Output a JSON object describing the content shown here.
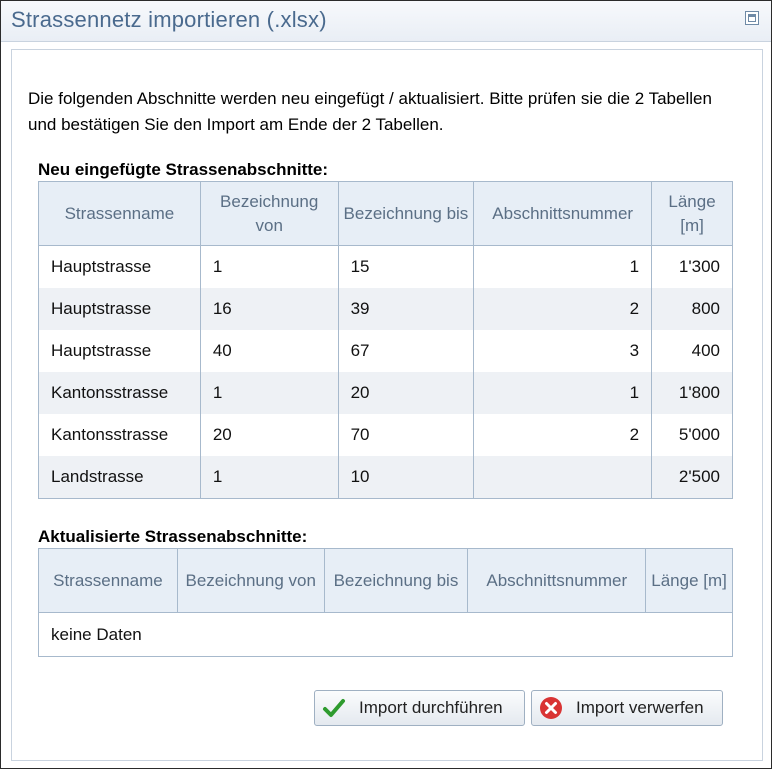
{
  "window": {
    "title": "Strassennetz importieren (.xlsx)"
  },
  "intro": "Die folgenden Abschnitte werden neu eingefügt / aktualisiert. Bitte prüfen sie die 2 Tabellen und bestätigen Sie den Import am Ende der 2 Tabellen.",
  "new_section": {
    "title": "Neu eingefügte Strassenabschnitte:",
    "headers": [
      "Strassenname",
      "Bezeichnung von",
      "Bezeichnung bis",
      "Abschnittsnummer",
      "Länge [m]"
    ],
    "rows": [
      [
        "Hauptstrasse",
        "1",
        "15",
        "1",
        "1'300"
      ],
      [
        "Hauptstrasse",
        "16",
        "39",
        "2",
        "800"
      ],
      [
        "Hauptstrasse",
        "40",
        "67",
        "3",
        "400"
      ],
      [
        "Kantonsstrasse",
        "1",
        "20",
        "1",
        "1'800"
      ],
      [
        "Kantonsstrasse",
        "20",
        "70",
        "2",
        "5'000"
      ],
      [
        "Landstrasse",
        "1",
        "10",
        "",
        "2'500"
      ]
    ]
  },
  "updated_section": {
    "title": "Aktualisierte Strassenabschnitte:",
    "headers": [
      "Strassenname",
      "Bezeichnung von",
      "Bezeichnung bis",
      "Abschnittsnummer",
      "Länge [m]"
    ],
    "empty_text": "keine Daten"
  },
  "buttons": {
    "import": "Import durchführen",
    "discard": "Import verwerfen"
  },
  "colors": {
    "title": "#4a6a8e",
    "header_bg": "#e7eef6",
    "check": "#2e9b2e",
    "cancel": "#d93434"
  }
}
